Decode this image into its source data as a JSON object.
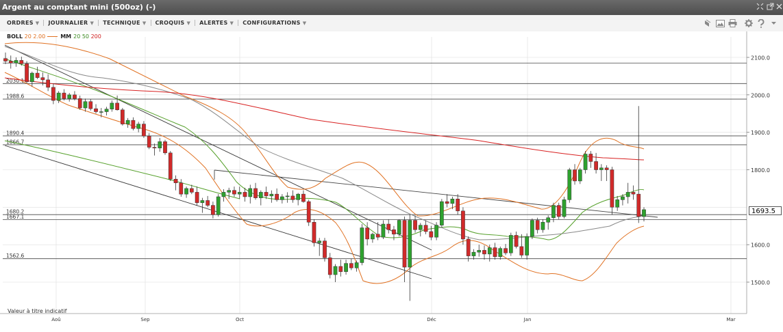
{
  "window": {
    "title": "Argent au comptant mini (500oz) (-)",
    "controls": [
      "expand-icon",
      "popout-icon",
      "close-icon"
    ]
  },
  "toolbar": {
    "menus": [
      {
        "label": "ORDRES"
      },
      {
        "label": "JOURNALIER"
      },
      {
        "label": "TECHNIQUE"
      },
      {
        "label": "CROQUIS"
      },
      {
        "label": "ALERTES"
      },
      {
        "label": "CONFIGURATIONS"
      }
    ],
    "icons": [
      "layers-icon",
      "image-icon",
      "print-icon",
      "gear-icon",
      "help-icon",
      "dropdown-icon"
    ]
  },
  "legend": {
    "boll_label": "BOLL",
    "boll_params": "20 2.00",
    "mm_label": "MM",
    "mm_20": "20",
    "mm_50": "50",
    "mm_200": "200"
  },
  "colors": {
    "up": "#2ea12e",
    "down": "#d12a2a",
    "bollinger": "#e07020",
    "ma20": "#55a02a",
    "ma50": "#777777",
    "ma200": "#d82020",
    "grid": "#dddddd"
  },
  "footer_note": "Valeur à titre indicatif",
  "last_price": "1693.5",
  "chart_data": {
    "type": "candlestick",
    "x_axis_labels": [
      "Aoû",
      "Sep",
      "Oct",
      "Déc",
      "Jan",
      "Mar"
    ],
    "y_axis_labels": [
      "2100.0",
      "2000.0",
      "1900.0",
      "1800.0",
      "1600.0",
      "1500.0"
    ],
    "ylim": [
      1440,
      2130
    ],
    "y_ticks": [
      1500,
      1600,
      1700,
      1800,
      1900,
      2000,
      2100
    ],
    "horizontal_levels": [
      {
        "label": "2030.1",
        "value": 2030.1
      },
      {
        "label": "1988.6",
        "value": 1988.6
      },
      {
        "label": "1890.4",
        "value": 1890.4
      },
      {
        "label": "1866.7",
        "value": 1866.7
      },
      {
        "label": "1680.2",
        "value": 1680.2
      },
      {
        "label": "1667.1",
        "value": 1667.1
      },
      {
        "label": "1562.6",
        "value": 1562.6
      }
    ],
    "unlabeled_levels": [
      2085
    ],
    "candles": [
      [
        2097,
        2113,
        2082,
        2090
      ],
      [
        2090,
        2105,
        2070,
        2085
      ],
      [
        2085,
        2100,
        2075,
        2092
      ],
      [
        2092,
        2102,
        2078,
        2083
      ],
      [
        2083,
        2090,
        2030,
        2035
      ],
      [
        2035,
        2062,
        2022,
        2058
      ],
      [
        2058,
        2075,
        2042,
        2046
      ],
      [
        2046,
        2060,
        2025,
        2040
      ],
      [
        2040,
        2055,
        2010,
        2020
      ],
      [
        2020,
        2030,
        1975,
        1985
      ],
      [
        1985,
        2010,
        1978,
        2005
      ],
      [
        2005,
        2015,
        1985,
        1990
      ],
      [
        1990,
        2005,
        1982,
        2000
      ],
      [
        2000,
        2010,
        1985,
        1990
      ],
      [
        1990,
        1998,
        1960,
        1965
      ],
      [
        1965,
        1990,
        1955,
        1982
      ],
      [
        1982,
        1988,
        1958,
        1963
      ],
      [
        1963,
        1975,
        1950,
        1955
      ],
      [
        1955,
        1965,
        1940,
        1955
      ],
      [
        1955,
        1968,
        1945,
        1962
      ],
      [
        1962,
        1985,
        1955,
        1978
      ],
      [
        1978,
        1998,
        1958,
        1960
      ],
      [
        1960,
        1965,
        1918,
        1922
      ],
      [
        1922,
        1938,
        1912,
        1932
      ],
      [
        1932,
        1940,
        1905,
        1910
      ],
      [
        1910,
        1928,
        1900,
        1922
      ],
      [
        1922,
        1930,
        1885,
        1890
      ],
      [
        1890,
        1898,
        1855,
        1860
      ],
      [
        1860,
        1870,
        1838,
        1858
      ],
      [
        1858,
        1885,
        1848,
        1875
      ],
      [
        1875,
        1880,
        1840,
        1845
      ],
      [
        1845,
        1850,
        1770,
        1775
      ],
      [
        1775,
        1785,
        1745,
        1765
      ],
      [
        1765,
        1775,
        1728,
        1735
      ],
      [
        1735,
        1755,
        1725,
        1750
      ],
      [
        1750,
        1760,
        1735,
        1740
      ],
      [
        1740,
        1755,
        1705,
        1712
      ],
      [
        1712,
        1725,
        1685,
        1718
      ],
      [
        1718,
        1730,
        1700,
        1705
      ],
      [
        1705,
        1715,
        1670,
        1680
      ],
      [
        1680,
        1735,
        1675,
        1728
      ],
      [
        1728,
        1748,
        1715,
        1740
      ],
      [
        1740,
        1752,
        1722,
        1745
      ],
      [
        1745,
        1755,
        1728,
        1735
      ],
      [
        1735,
        1755,
        1722,
        1740
      ],
      [
        1740,
        1752,
        1715,
        1728
      ],
      [
        1728,
        1760,
        1710,
        1750
      ],
      [
        1750,
        1765,
        1720,
        1725
      ],
      [
        1725,
        1745,
        1705,
        1740
      ],
      [
        1740,
        1755,
        1722,
        1730
      ],
      [
        1730,
        1745,
        1712,
        1735
      ],
      [
        1735,
        1750,
        1715,
        1720
      ],
      [
        1720,
        1735,
        1710,
        1728
      ],
      [
        1728,
        1740,
        1712,
        1730
      ],
      [
        1730,
        1745,
        1712,
        1720
      ],
      [
        1720,
        1738,
        1705,
        1735
      ],
      [
        1735,
        1745,
        1712,
        1715
      ],
      [
        1715,
        1720,
        1650,
        1660
      ],
      [
        1660,
        1668,
        1595,
        1605
      ],
      [
        1605,
        1618,
        1570,
        1610
      ],
      [
        1610,
        1618,
        1555,
        1565
      ],
      [
        1565,
        1578,
        1510,
        1520
      ],
      [
        1520,
        1548,
        1500,
        1542
      ],
      [
        1542,
        1560,
        1515,
        1528
      ],
      [
        1528,
        1560,
        1520,
        1550
      ],
      [
        1550,
        1562,
        1532,
        1538
      ],
      [
        1538,
        1558,
        1528,
        1552
      ],
      [
        1552,
        1655,
        1545,
        1645
      ],
      [
        1645,
        1660,
        1598,
        1615
      ],
      [
        1615,
        1632,
        1605,
        1628
      ],
      [
        1628,
        1660,
        1612,
        1620
      ],
      [
        1620,
        1665,
        1615,
        1655
      ],
      [
        1655,
        1668,
        1630,
        1640
      ],
      [
        1640,
        1650,
        1612,
        1628
      ],
      [
        1628,
        1668,
        1622,
        1665
      ],
      [
        1665,
        1675,
        1500,
        1540
      ],
      [
        1540,
        1680,
        1450,
        1665
      ],
      [
        1665,
        1678,
        1632,
        1640
      ],
      [
        1640,
        1658,
        1622,
        1652
      ],
      [
        1652,
        1665,
        1628,
        1635
      ],
      [
        1635,
        1650,
        1612,
        1620
      ],
      [
        1620,
        1660,
        1612,
        1652
      ],
      [
        1652,
        1722,
        1645,
        1715
      ],
      [
        1715,
        1735,
        1700,
        1710
      ],
      [
        1710,
        1728,
        1695,
        1722
      ],
      [
        1722,
        1735,
        1680,
        1690
      ],
      [
        1690,
        1700,
        1600,
        1615
      ],
      [
        1615,
        1622,
        1555,
        1570
      ],
      [
        1570,
        1588,
        1560,
        1580
      ],
      [
        1580,
        1600,
        1568,
        1585
      ],
      [
        1585,
        1598,
        1560,
        1575
      ],
      [
        1575,
        1600,
        1555,
        1592
      ],
      [
        1592,
        1605,
        1560,
        1568
      ],
      [
        1568,
        1595,
        1560,
        1590
      ],
      [
        1590,
        1602,
        1572,
        1578
      ],
      [
        1578,
        1632,
        1570,
        1625
      ],
      [
        1625,
        1635,
        1590,
        1595
      ],
      [
        1595,
        1628,
        1565,
        1572
      ],
      [
        1572,
        1630,
        1560,
        1622
      ],
      [
        1622,
        1670,
        1615,
        1665
      ],
      [
        1665,
        1672,
        1630,
        1640
      ],
      [
        1640,
        1668,
        1632,
        1660
      ],
      [
        1660,
        1678,
        1640,
        1672
      ],
      [
        1672,
        1712,
        1660,
        1705
      ],
      [
        1705,
        1712,
        1668,
        1675
      ],
      [
        1675,
        1728,
        1670,
        1720
      ],
      [
        1720,
        1805,
        1712,
        1800
      ],
      [
        1800,
        1815,
        1760,
        1770
      ],
      [
        1770,
        1805,
        1762,
        1800
      ],
      [
        1800,
        1850,
        1790,
        1842
      ],
      [
        1842,
        1850,
        1805,
        1822
      ],
      [
        1822,
        1845,
        1790,
        1800
      ],
      [
        1800,
        1815,
        1770,
        1805
      ],
      [
        1805,
        1812,
        1770,
        1800
      ],
      [
        1800,
        1808,
        1680,
        1700
      ],
      [
        1700,
        1730,
        1690,
        1720
      ],
      [
        1720,
        1735,
        1705,
        1728
      ],
      [
        1728,
        1765,
        1710,
        1740
      ],
      [
        1740,
        1758,
        1720,
        1735
      ],
      [
        1735,
        1970,
        1658,
        1675
      ],
      [
        1675,
        1700,
        1662,
        1693.5
      ]
    ]
  }
}
